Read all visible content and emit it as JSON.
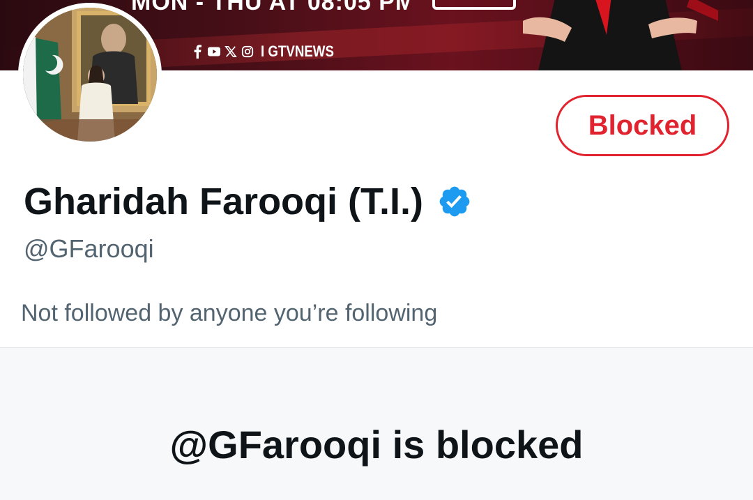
{
  "banner": {
    "headline": "MON - THU AT 08:05 PM",
    "social_handle": "I GTVNEWS",
    "social_icons": [
      "facebook-icon",
      "youtube-icon",
      "x-icon",
      "instagram-icon"
    ]
  },
  "profile": {
    "display_name": "Gharidah Farooqi (T.I.)",
    "handle": "@GFarooqi",
    "verified": true,
    "follow_context": "Not followed by anyone you’re following"
  },
  "actions": {
    "blocked_label": "Blocked"
  },
  "blocked_notice": {
    "title": "@GFarooqi is blocked"
  },
  "colors": {
    "blocked_red": "#e0232f",
    "verified_blue": "#1d9bf0",
    "secondary_text": "#536471",
    "panel_bg": "#f7f8f9"
  }
}
